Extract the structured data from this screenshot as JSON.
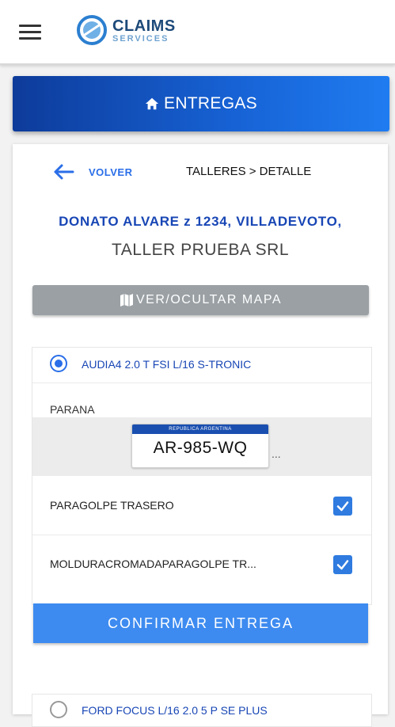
{
  "header": {
    "logo_main": "CLAIMS",
    "logo_sub": "SERVICES"
  },
  "banner": {
    "icon": "home-icon",
    "title": "ENTREGAS"
  },
  "nav": {
    "back_label": "VOLVER",
    "breadcrumb": "TALLERES > DETALLE"
  },
  "workshop": {
    "address": "DONATO ALVARE z 1234, VILLADEVOTO,",
    "name": "TALLER PRUEBA SRL"
  },
  "map_button": {
    "icon": "map-icon",
    "label": "VER/OCULTAR MAPA"
  },
  "vehicles": [
    {
      "name": "AUDIA4 2.0 T FSI L/16 S-TRONIC",
      "selected": true,
      "city": "PARANA",
      "plate": {
        "header": "REPUBLICA ARGENTINA",
        "number": "AR-985-WQ",
        "more": "..."
      },
      "parts": [
        {
          "label": "PARAGOLPE TRASERO",
          "checked": true
        },
        {
          "label": "MOLDURACROMADAPARAGOLPE TR...",
          "checked": true
        }
      ]
    },
    {
      "name": "FORD FOCUS L/16 2.0 5 P SE PLUS",
      "selected": false
    }
  ],
  "confirm_button": {
    "label": "CONFIRMAR ENTREGA"
  },
  "colors": {
    "primary": "#1846b5",
    "accent": "#3d8bf0",
    "banner_start": "#0d3b9a",
    "banner_end": "#1f7cf0",
    "map_button": "#9aa0a4"
  }
}
